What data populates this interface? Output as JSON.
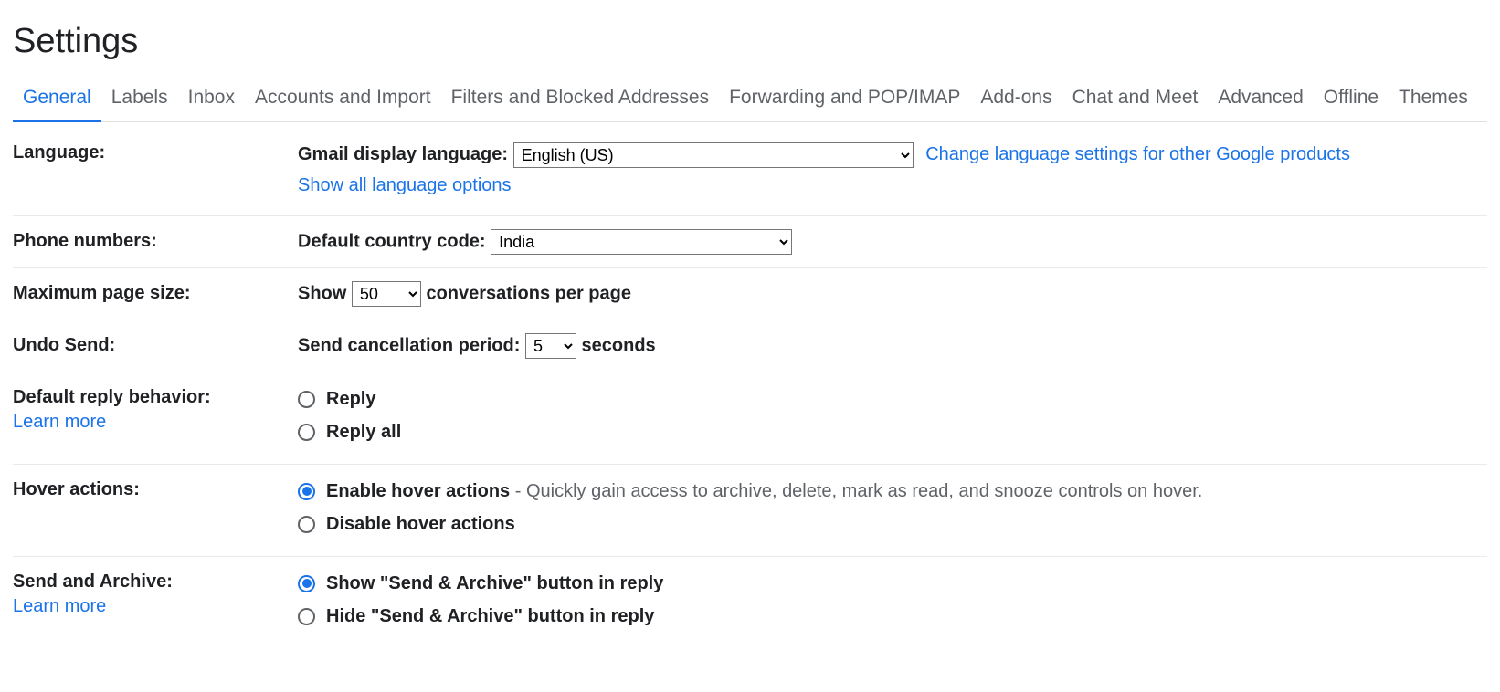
{
  "title": "Settings",
  "tabs": {
    "general": "General",
    "labels": "Labels",
    "inbox": "Inbox",
    "accounts": "Accounts and Import",
    "filters": "Filters and Blocked Addresses",
    "forwarding": "Forwarding and POP/IMAP",
    "addons": "Add-ons",
    "chat": "Chat and Meet",
    "advanced": "Advanced",
    "offline": "Offline",
    "themes": "Themes"
  },
  "language": {
    "label": "Language:",
    "display_label": "Gmail display language:",
    "selected": "English (US)",
    "change_link": "Change language settings for other Google products",
    "show_all": "Show all language options"
  },
  "phone": {
    "label": "Phone numbers:",
    "code_label": "Default country code:",
    "selected": "India"
  },
  "pagesize": {
    "label": "Maximum page size:",
    "show": "Show",
    "selected": "50",
    "suffix": "conversations per page"
  },
  "undo": {
    "label": "Undo Send:",
    "prefix": "Send cancellation period:",
    "selected": "5",
    "suffix": "seconds"
  },
  "reply": {
    "label": "Default reply behavior:",
    "learn_more": "Learn more",
    "opt1": "Reply",
    "opt2": "Reply all"
  },
  "hover": {
    "label": "Hover actions:",
    "opt1": "Enable hover actions",
    "opt1_desc": " - Quickly gain access to archive, delete, mark as read, and snooze controls on hover.",
    "opt2": "Disable hover actions"
  },
  "sendarchive": {
    "label": "Send and Archive:",
    "learn_more": "Learn more",
    "opt1": "Show \"Send & Archive\" button in reply",
    "opt2": "Hide \"Send & Archive\" button in reply"
  }
}
